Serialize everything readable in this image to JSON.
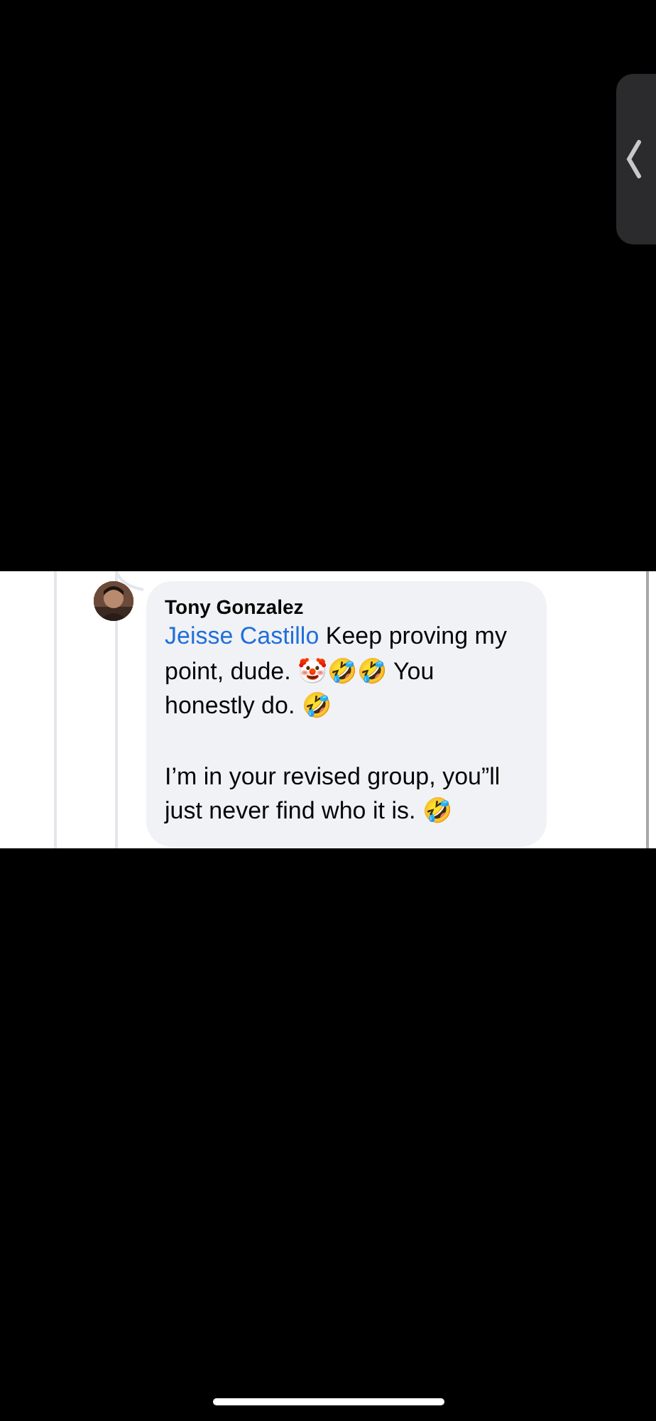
{
  "comment": {
    "author": "Tony Gonzalez",
    "mention": "Jeisse Castillo",
    "paragraphs": [
      "Keep proving my point, dude. 🤡🤣🤣 You honestly do. 🤣",
      "I’m in your revised group, you”ll just never find who it is. 🤣"
    ]
  }
}
